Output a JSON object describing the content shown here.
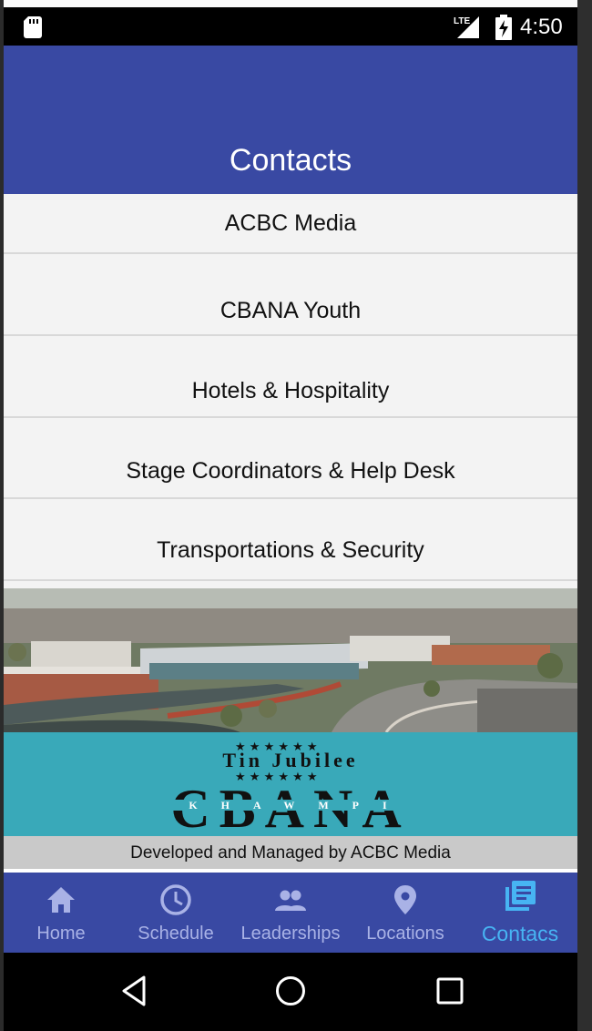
{
  "status_bar": {
    "network": "LTE",
    "time": "4:50"
  },
  "app_bar": {
    "title": "Contacts"
  },
  "contacts": [
    {
      "label": "ACBC Media"
    },
    {
      "label": "CBANA Youth"
    },
    {
      "label": "Hotels & Hospitality"
    },
    {
      "label": "Stage Coordinators & Help Desk"
    },
    {
      "label": "Transportations & Security"
    }
  ],
  "banner": {
    "line1": "Tin Jubilee",
    "line2": "CBANA",
    "line3": "KHAWMPI"
  },
  "credit": {
    "text": "Developed and Managed by ACBC Media"
  },
  "bottom_nav": {
    "items": [
      {
        "label": "Home",
        "icon": "home-icon",
        "active": false
      },
      {
        "label": "Schedule",
        "icon": "clock-icon",
        "active": false
      },
      {
        "label": "Leaderships",
        "icon": "people-icon",
        "active": false
      },
      {
        "label": "Locations",
        "icon": "location-pin-icon",
        "active": false
      },
      {
        "label": "Contacs",
        "icon": "book-icon",
        "active": true
      }
    ]
  },
  "colors": {
    "app_bar": "#3949a3",
    "nav_inactive": "#a9b2e6",
    "nav_active": "#47b4f3",
    "banner": "#39a9b9"
  }
}
